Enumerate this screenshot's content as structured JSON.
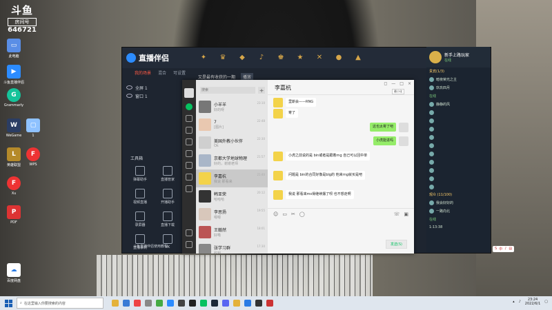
{
  "desktop": {
    "douyu": {
      "brand": "斗鱼",
      "room_label": "房间号",
      "room_number": "646721"
    },
    "icons": [
      {
        "label": "此电脑"
      },
      {
        "label": "斗鱼直播伴侣"
      },
      {
        "label": "Grammarly"
      },
      {
        "label": "WeGame"
      },
      {
        "label": "1"
      },
      {
        "label": "英雄联盟"
      },
      {
        "label": "WPS"
      },
      {
        "label": "Xu"
      },
      {
        "label": "PDF"
      },
      {
        "label": "百度网盘"
      }
    ]
  },
  "assistant": {
    "title": "直播伴侣",
    "tabs": [
      {
        "label": "我的场景"
      },
      {
        "label": "混合"
      },
      {
        "label": "可设置"
      }
    ],
    "subtabs": {
      "label": "又是最有收获的一期",
      "tag": "播放"
    },
    "scenes": [
      {
        "label": "全屏 1"
      },
      {
        "label": "窗口 1"
      }
    ],
    "tools_title": "工具箱",
    "tools": [
      {
        "label": "弹幕助手"
      },
      {
        "label": "直播管家"
      },
      {
        "label": "视频直播"
      },
      {
        "label": "开播助手"
      },
      {
        "label": "录屏器"
      },
      {
        "label": "直播下载"
      },
      {
        "label": "直播录制"
      },
      {
        "label": "PK"
      }
    ],
    "footer": "斗鱼直播伴侣使用教程",
    "winctl": [
      "—",
      "□",
      "×"
    ]
  },
  "right_panel": {
    "user_name": "新手上路玩家",
    "user_level": "在线",
    "sections": [
      {
        "title": "贵宾(1/3)",
        "lines": [
          "暗夜荣光之主",
          "玖玖四月",
          "在线",
          "静静的风"
        ]
      },
      {
        "title": "观众 (11/100)",
        "lines": [
          "我会好好的",
          "一路向北",
          "在线"
        ]
      }
    ],
    "bottom_counter": "1:13:38"
  },
  "wechat": {
    "search_placeholder": "搜索",
    "chats": [
      {
        "name": "小羊羊",
        "preview": "好的呀",
        "time": "23:10"
      },
      {
        "name": "7",
        "preview": "[图片]",
        "time": "22:48"
      },
      {
        "name": "美国外教小伙伴",
        "preview": "Ok",
        "time": "22:30"
      },
      {
        "name": "京都大学地球物理",
        "preview": "好的，谢谢老师",
        "time": "21:57"
      },
      {
        "name": "李嘉杭",
        "preview": "我说 那看来",
        "time": "21:40"
      },
      {
        "name": "韩亚荣",
        "preview": "哈哈哈",
        "time": "20:12"
      },
      {
        "name": "李思扬",
        "preview": "嗯嗯",
        "time": "19:55"
      },
      {
        "name": "王翰然",
        "preview": "好嘞",
        "time": "18:01"
      },
      {
        "name": "张学习群",
        "preview": "收到",
        "time": "17:30"
      }
    ],
    "active_chat": "李嘉杭",
    "tooltip": "最小化",
    "winctl": [
      "◻",
      "—",
      "□",
      "×"
    ],
    "messages": [
      {
        "side": "left",
        "text": "里斯会——RNG"
      },
      {
        "side": "left",
        "text": "寄了"
      },
      {
        "side": "right",
        "text": "这也太寄了吧"
      },
      {
        "side": "right",
        "text": "小虎能进吗"
      },
      {
        "side": "left",
        "text": "小虎之前说的是 bin或者是跟着rng 自己可以回中单"
      },
      {
        "side": "left",
        "text": "问题是 bin的合同好像是blg的 他来rng就买是吧"
      },
      {
        "side": "left",
        "text": "我说 那看来ms得继续摆了呗 也不想走啊"
      }
    ],
    "send_label": "发送(S)"
  },
  "taskbar": {
    "search_placeholder": "在这里输入你要搜索的内容",
    "time": "23:24",
    "date": "2022/6/1",
    "ime": "中"
  },
  "colors": {
    "accent": "#07c160",
    "assistant_bg": "#1e2530",
    "brand_red": "#ff5a45"
  }
}
